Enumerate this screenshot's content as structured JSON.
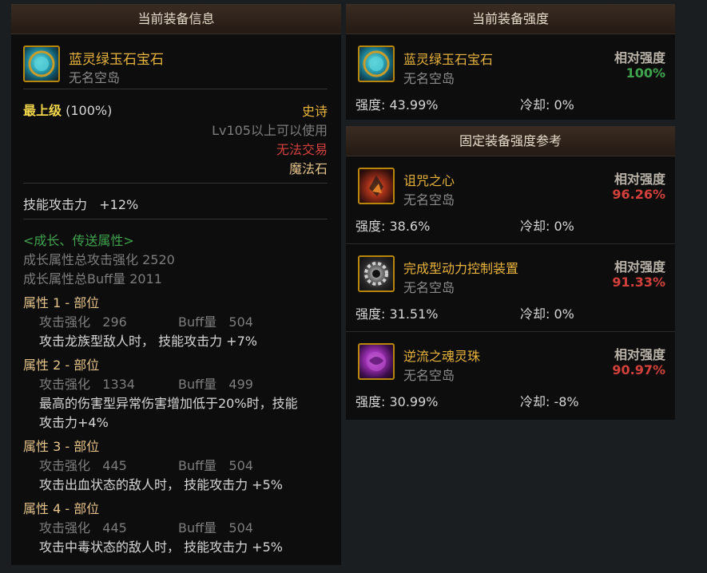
{
  "left": {
    "title": "当前装备信息",
    "item": {
      "name": "蓝灵绿玉石宝石",
      "source": "无名空岛",
      "icon": "gem-icon"
    },
    "grade_label": "最上级",
    "grade_pct": "(100%)",
    "rarity": "史诗",
    "level_req": "Lv105以上可以使用",
    "trade": "无法交易",
    "type": "魔法石",
    "stat": "技能攻击力   +12%",
    "growth_title": "<成长、传送属性>",
    "growth_attack": "成长属性总攻击强化 2520",
    "growth_buff": "成长属性总Buff量 2011",
    "attributes": [
      {
        "title": "属性 1 - 部位",
        "atk": "攻击强化   296",
        "buff": "Buff量   504",
        "desc": "攻击龙族型敌人时， 技能攻击力 +7%"
      },
      {
        "title": "属性 2 - 部位",
        "atk": "攻击强化   1334",
        "buff": "Buff量   499",
        "desc": "最高的伤害型异常伤害增加低于20%时，技能",
        "desc2": "攻击力+4%"
      },
      {
        "title": "属性 3 - 部位",
        "atk": "攻击强化   445",
        "buff": "Buff量   504",
        "desc": "攻击出血状态的敌人时， 技能攻击力 +5%"
      },
      {
        "title": "属性 4 - 部位",
        "atk": "攻击强化   445",
        "buff": "Buff量   504",
        "desc": "攻击中毒状态的敌人时， 技能攻击力 +5%"
      }
    ]
  },
  "current": {
    "title": "当前装备强度",
    "name": "蓝灵绿玉石宝石",
    "source": "无名空岛",
    "rel_label": "相对强度",
    "rel_value": "100%",
    "strength": "强度: 43.99%",
    "cooldown": "冷却: 0%"
  },
  "reference": {
    "title": "固定装备强度参考",
    "rel_label": "相对强度",
    "items": [
      {
        "name": "诅咒之心",
        "source": "无名空岛",
        "rel_value": "96.26%",
        "strength": "强度: 38.6%",
        "cooldown": "冷却: 0%",
        "icon": "cursed-heart-icon"
      },
      {
        "name": "完成型动力控制装置",
        "source": "无名空岛",
        "rel_value": "91.33%",
        "strength": "强度: 31.51%",
        "cooldown": "冷却: 0%",
        "icon": "power-control-device-icon"
      },
      {
        "name": "逆流之魂灵珠",
        "source": "无名空岛",
        "rel_value": "90.97%",
        "strength": "强度: 30.99%",
        "cooldown": "冷却: -8%",
        "icon": "soul-orb-icon"
      }
    ]
  }
}
